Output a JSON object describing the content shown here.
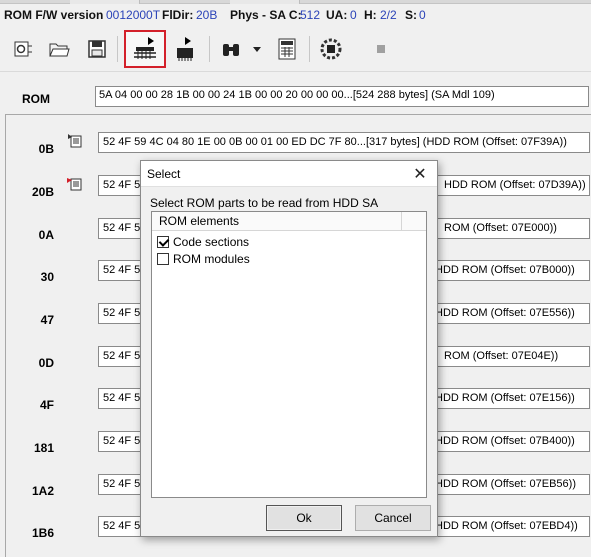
{
  "status": {
    "rom_fw_label": "ROM F/W version",
    "rom_fw_value": "0012000T",
    "fldir_label": "FlDir:",
    "fldir_value": "20B",
    "phys_label": "Phys - SA C:",
    "phys_value": "512",
    "ua_label": "UA:",
    "ua_value": "0",
    "h_label": "H:",
    "h_value": "2/2",
    "s_label": "S:",
    "s_value": "0"
  },
  "toolbar": {
    "buttons": [
      "chip-settings-icon",
      "open-folder-icon",
      "save-icon",
      "read-rom-from-sa-icon",
      "write-chip-icon",
      "binoculars-icon",
      "dropdown-arrow-icon",
      "calculator-icon",
      "chip-gear-icon",
      "stop-icon"
    ]
  },
  "rom": {
    "label": "ROM",
    "value": "5A 04 00 00 28 1B 00 00 24 1B 00 00 20 00 00 00...[524 288 bytes] (SA Mdl 109)"
  },
  "rows": [
    {
      "name": "0B",
      "hex": "52 4F 59 4C 04 80 1E 00 0B 00 01 00 ED DC 7F 80...[317 bytes] (HDD ROM (Offset: 07F39A))",
      "tail": ""
    },
    {
      "name": "20B",
      "hex": "52 4F 59",
      "tail": "HDD ROM (Offset: 07D39A))"
    },
    {
      "name": "0A",
      "hex": "52 4F 59",
      "tail": "ROM (Offset: 07E000))"
    },
    {
      "name": "30",
      "hex": "52 4F 59",
      "tail": "HDD ROM (Offset: 07B000))"
    },
    {
      "name": "47",
      "hex": "52 4F 59",
      "tail": "HDD ROM (Offset: 07E556))"
    },
    {
      "name": "0D",
      "hex": "52 4F 59",
      "tail": "ROM (Offset: 07E04E))"
    },
    {
      "name": "4F",
      "hex": "52 4F 59",
      "tail": "HDD ROM (Offset: 07E156))"
    },
    {
      "name": "181",
      "hex": "52 4F 59",
      "tail": "HDD ROM (Offset: 07B400))"
    },
    {
      "name": "1A2",
      "hex": "52 4F 59",
      "tail": "HDD ROM (Offset: 07EB56))"
    },
    {
      "name": "1B6",
      "hex": "52 4F 59",
      "tail": "HDD ROM (Offset: 07EBD4))"
    }
  ],
  "dialog": {
    "title": "Select",
    "close": "✕",
    "description": "Select ROM parts to be read from HDD SA",
    "column_header": "ROM elements",
    "items": [
      {
        "label": "Code sections",
        "checked": true
      },
      {
        "label": "ROM modules",
        "checked": false
      }
    ],
    "ok": "Ok",
    "cancel": "Cancel"
  },
  "colors": {
    "value_blue": "#2b43b8",
    "highlight_red": "#d3202a"
  }
}
